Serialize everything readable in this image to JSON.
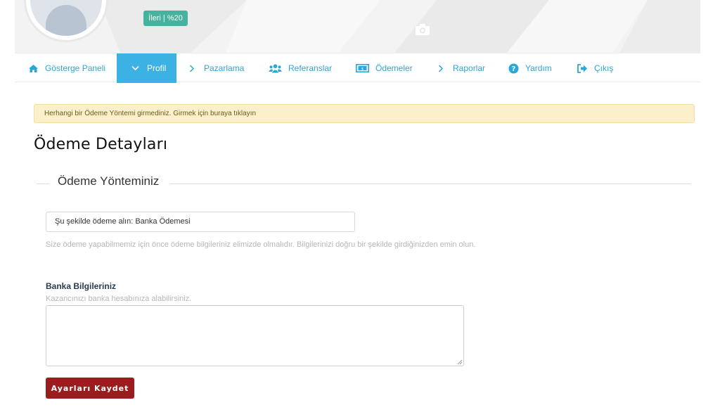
{
  "profile": {
    "level_badge": "İleri | %20"
  },
  "nav": {
    "items": [
      {
        "label": "Gösterge Paneli",
        "icon": "home-icon"
      },
      {
        "label": "Profil",
        "icon": "chevron-down-icon",
        "active": true
      },
      {
        "label": "Pazarlama",
        "icon": "chevron-right-icon"
      },
      {
        "label": "Referanslar",
        "icon": "users-icon"
      },
      {
        "label": "Ödemeler",
        "icon": "money-icon"
      },
      {
        "label": "Raporlar",
        "icon": "chevron-right-icon"
      },
      {
        "label": "Yardım",
        "icon": "question-circle-icon"
      },
      {
        "label": "Çıkış",
        "icon": "sign-out-icon"
      }
    ]
  },
  "alert": {
    "text": "Herhangi bir Ödeme Yöntemi girmediniz. Girmek için buraya tıklayın"
  },
  "page": {
    "title": "Ödeme Detayları",
    "section_legend": "Ödeme Yönteminiz",
    "method_value": "Şu şekilde ödeme alın: Banka Ödemesi",
    "method_help": "Size ödeme yapabilmemiz için önce ödeme bilgileriniz elimizde olmalıdır. Bilgilerinizi doğru bir şekilde girdiğinizden emin olun.",
    "bank_label": "Banka Bilgileriniz",
    "bank_help": "Kazancınızı banka hesabınıza alabilirsiniz.",
    "bank_value": "",
    "save_label": "Ayarları Kaydet"
  },
  "colors": {
    "accent": "#2aa7d8",
    "active_nav_bg": "#3cb2e4",
    "badge_bg": "#45b39d",
    "alert_bg": "#fcf0cb",
    "save_button_bg": "#9b1c1c"
  }
}
